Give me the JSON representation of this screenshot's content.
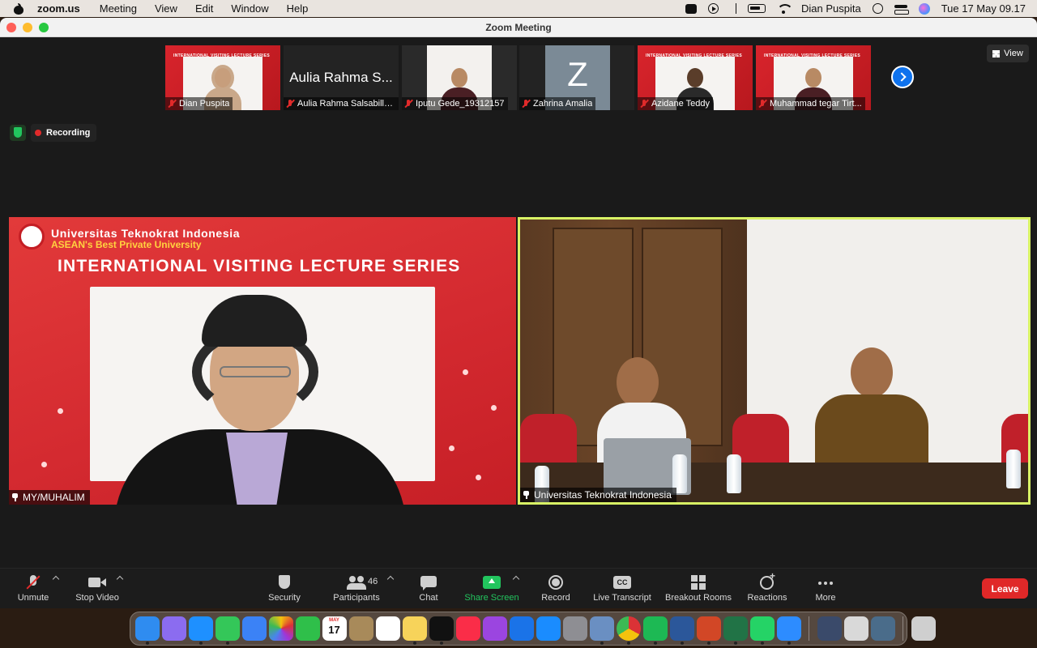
{
  "menubar": {
    "app_name": "zoom.us",
    "menus": [
      "Meeting",
      "View",
      "Edit",
      "Window",
      "Help"
    ],
    "user": "Dian Puspita",
    "clock": "Tue 17 May  09.17"
  },
  "window": {
    "title": "Zoom Meeting"
  },
  "thumbnails": [
    {
      "name": "Dian Puspita",
      "type": "slide",
      "muted": true
    },
    {
      "name": "Aulia Rahma Salsabilla...",
      "big_name": "Aulia Rahma S...",
      "type": "name",
      "muted": true
    },
    {
      "name": "Iputu Gede_19312157",
      "type": "video",
      "muted": true
    },
    {
      "name": "Zahrina Amalia",
      "letter": "Z",
      "type": "avatar",
      "muted": true
    },
    {
      "name": "Azidane Teddy",
      "type": "slide",
      "muted": true
    },
    {
      "name": "Muhammad tegar Tirt...",
      "type": "slide",
      "muted": true
    }
  ],
  "thumb_slide_header": "INTERNATIONAL VISITING LECTURE SERIES",
  "view_button": "View",
  "recording_label": "Recording",
  "main_left": {
    "university": "Universitas Teknokrat Indonesia",
    "tagline": "ASEAN's Best Private University",
    "series_title": "INTERNATIONAL VISITING LECTURE SERIES",
    "name": "MY/MUHALIM",
    "name_suffix": "s Teknol"
  },
  "main_right": {
    "name": "Universitas Teknokrat Indonesia",
    "active_speaker_color": "#d8f265"
  },
  "toolbar": {
    "unmute": "Unmute",
    "stop_video": "Stop Video",
    "security": "Security",
    "participants": "Participants",
    "participants_count": "46",
    "chat": "Chat",
    "share_screen": "Share Screen",
    "record": "Record",
    "live_transcript": "Live Transcript",
    "breakout_rooms": "Breakout Rooms",
    "reactions": "Reactions",
    "more": "More",
    "leave": "Leave"
  },
  "dock": {
    "apps": [
      "Finder",
      "Launchpad",
      "Safari",
      "Messages",
      "Mail",
      "Photos",
      "FaceTime",
      "Calendar",
      "Notes Scanner",
      "Reminders",
      "Notes",
      "Apple TV",
      "Music",
      "Podcasts",
      "Keynote",
      "App Store",
      "System Preferences",
      "Preview",
      "Chrome",
      "Spotify",
      "Word",
      "PowerPoint",
      "Excel",
      "WhatsApp",
      "Zoom",
      "Recent Doc 1",
      "Recent Doc 2",
      "Recent Doc 3",
      "Trash"
    ],
    "calendar_day": "17",
    "colors": {
      "Finder": "#2f8cf0",
      "Launchpad": "#8b6cf0",
      "Safari": "#1e90ff",
      "Messages": "#34c759",
      "Mail": "#3b82f6",
      "Photos": "#ffffff",
      "FaceTime": "#2fbf4a",
      "Calendar": "#ffffff",
      "Notes Scanner": "#a88a5a",
      "Reminders": "#ffffff",
      "Notes": "#f7d35a",
      "Apple TV": "#111111",
      "Music": "#fa2d48",
      "Podcasts": "#9b45e0",
      "Keynote": "#1a73e8",
      "App Store": "#1a8cff",
      "System Preferences": "#8e8e93",
      "Preview": "#6a8fc2",
      "Chrome": "#f1c232",
      "Spotify": "#1db954",
      "Word": "#2b579a",
      "PowerPoint": "#d24726",
      "Excel": "#217346",
      "WhatsApp": "#25d366",
      "Zoom": "#2d8cff",
      "Recent Doc 1": "#3a4a6a",
      "Recent Doc 2": "#d9d9d9",
      "Recent Doc 3": "#4a6c8a",
      "Trash": "#cfcfcf"
    }
  }
}
